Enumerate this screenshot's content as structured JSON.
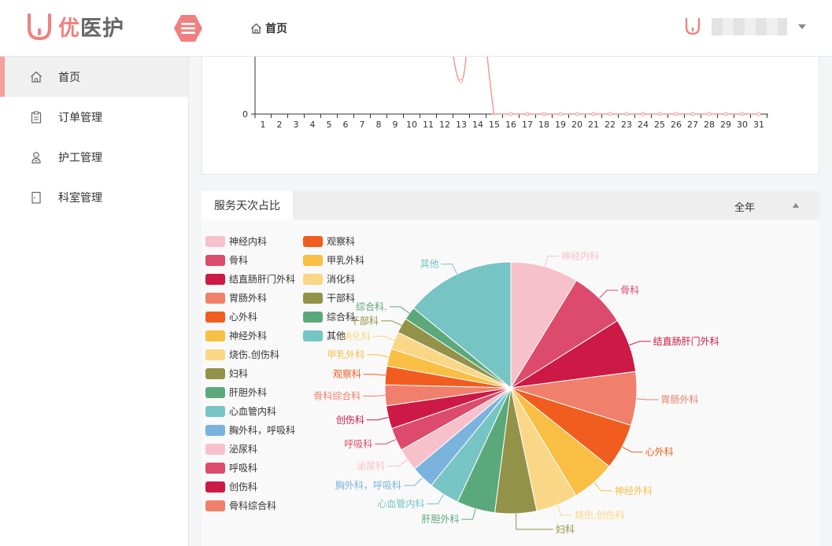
{
  "app": {
    "logo_text_accent": "优",
    "logo_text_main": "医护",
    "brand_color": "#f08080"
  },
  "header": {
    "breadcrumb_home": "首页"
  },
  "sidebar": {
    "items": [
      {
        "label": "首页",
        "icon": "home-icon",
        "active": true
      },
      {
        "label": "订单管理",
        "icon": "clipboard-icon",
        "active": false
      },
      {
        "label": "护工管理",
        "icon": "user-icon",
        "active": false
      },
      {
        "label": "科室管理",
        "icon": "door-icon",
        "active": false
      }
    ]
  },
  "line_chart": {
    "y_tick": "0",
    "x_ticks": [
      "1",
      "2",
      "3",
      "4",
      "5",
      "6",
      "7",
      "8",
      "9",
      "10",
      "11",
      "12",
      "13",
      "14",
      "15",
      "16",
      "17",
      "18",
      "19",
      "20",
      "21",
      "22",
      "23",
      "24",
      "25",
      "26",
      "27",
      "28",
      "29",
      "30",
      "31"
    ]
  },
  "pie_panel": {
    "tab_label": "服务天次占比",
    "period_select": "全年"
  },
  "chart_data": {
    "type": "pie",
    "title": "服务天次占比",
    "slices": [
      {
        "name": "神经内科",
        "value": 6.2,
        "color": "#f7c1cb",
        "side": "right"
      },
      {
        "name": "骨科",
        "value": 5.2,
        "color": "#dc4a6c",
        "side": "right"
      },
      {
        "name": "结直肠肝门外科",
        "value": 4.9,
        "color": "#cc1945",
        "side": "right"
      },
      {
        "name": "胃肠外科",
        "value": 4.9,
        "color": "#f0806c",
        "side": "right"
      },
      {
        "name": "心外科",
        "value": 4.2,
        "color": "#f05d1f",
        "side": "right"
      },
      {
        "name": "神经外科",
        "value": 4.0,
        "color": "#f9be44",
        "side": "right"
      },
      {
        "name": "烧伤.创伤科",
        "value": 3.8,
        "color": "#fad687",
        "side": "right"
      },
      {
        "name": "妇科",
        "value": 3.8,
        "color": "#939249",
        "side": "right"
      },
      {
        "name": "肝胆外科",
        "value": 3.5,
        "color": "#5ba97b",
        "side": "left"
      },
      {
        "name": "心血管内科",
        "value": 2.8,
        "color": "#76c4c4",
        "side": "left"
      },
      {
        "name": "胸外科，呼吸科",
        "value": 2.1,
        "color": "#7ab3de",
        "side": "left"
      },
      {
        "name": "泌尿科",
        "value": 2.1,
        "color": "#f7c1cb",
        "side": "left"
      },
      {
        "name": "呼吸科",
        "value": 2.1,
        "color": "#dc4a6c",
        "side": "left"
      },
      {
        "name": "创伤科",
        "value": 2.1,
        "color": "#cc1945",
        "side": "left"
      },
      {
        "name": "骨科综合科",
        "value": 1.9,
        "color": "#f0806c",
        "side": "left"
      },
      {
        "name": "观察科",
        "value": 1.7,
        "color": "#f05d1f",
        "side": "left"
      },
      {
        "name": "甲乳外科",
        "value": 1.6,
        "color": "#f9be44",
        "side": "left"
      },
      {
        "name": "消化科",
        "value": 1.6,
        "color": "#fad687",
        "side": "left"
      },
      {
        "name": "干部科",
        "value": 1.4,
        "color": "#939249",
        "side": "left"
      },
      {
        "name": "综合科.",
        "value": 1.2,
        "color": "#5ba97b",
        "side": "left"
      },
      {
        "name": "其他",
        "value": 10.0,
        "color": "#76c4c4",
        "side": "left"
      }
    ],
    "legend": [
      {
        "name": "神经内科",
        "color": "#f7c1cb"
      },
      {
        "name": "骨科",
        "color": "#dc4a6c"
      },
      {
        "name": "结直肠肝门外科",
        "color": "#cc1945"
      },
      {
        "name": "胃肠外科",
        "color": "#f0806c"
      },
      {
        "name": "心外科",
        "color": "#f05d1f"
      },
      {
        "name": "神经外科",
        "color": "#f9be44"
      },
      {
        "name": "烧伤.创伤科",
        "color": "#fad687"
      },
      {
        "name": "妇科",
        "color": "#939249"
      },
      {
        "name": "肝胆外科",
        "color": "#5ba97b"
      },
      {
        "name": "心血管内科",
        "color": "#76c4c4"
      },
      {
        "name": "胸外科，呼吸科",
        "color": "#7ab3de"
      },
      {
        "name": "泌尿科",
        "color": "#f7c1cb"
      },
      {
        "name": "呼吸科",
        "color": "#dc4a6c"
      },
      {
        "name": "创伤科",
        "color": "#cc1945"
      },
      {
        "name": "骨科综合科",
        "color": "#f0806c"
      },
      {
        "name": "观察科",
        "color": "#f05d1f"
      },
      {
        "name": "甲乳外科",
        "color": "#f9be44"
      },
      {
        "name": "消化科",
        "color": "#fad687"
      },
      {
        "name": "干部科",
        "color": "#939249"
      },
      {
        "name": "综合科.",
        "color": "#5ba97b"
      },
      {
        "name": "其他",
        "color": "#76c4c4"
      }
    ]
  }
}
